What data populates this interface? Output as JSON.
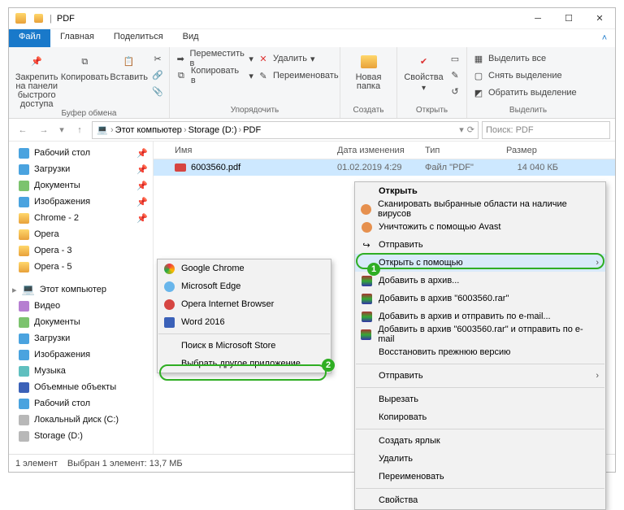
{
  "window": {
    "title": "PDF"
  },
  "tabs": {
    "file": "Файл",
    "home": "Главная",
    "share": "Поделиться",
    "view": "Вид"
  },
  "ribbon": {
    "clipboard": {
      "label": "Буфер обмена",
      "pin": "Закрепить на панели\nбыстрого доступа",
      "copy": "Копировать",
      "paste": "Вставить",
      "cut": "",
      "copypath": "Копировать путь",
      "pastelink": "Вставить ярлык"
    },
    "organize": {
      "label": "Упорядочить",
      "moveto": "Переместить в",
      "copyto": "Копировать в",
      "delete": "Удалить",
      "rename": "Переименовать"
    },
    "new": {
      "label": "Создать",
      "folder": "Новая\nпапка"
    },
    "open": {
      "label": "Открыть",
      "props": "Свойства"
    },
    "select": {
      "label": "Выделить",
      "all": "Выделить все",
      "none": "Снять выделение",
      "invert": "Обратить выделение"
    }
  },
  "breadcrumb": [
    "Этот компьютер",
    "Storage (D:)",
    "PDF"
  ],
  "search": {
    "placeholder": "Поиск: PDF"
  },
  "columns": {
    "name": "Имя",
    "date": "Дата изменения",
    "type": "Тип",
    "size": "Размер"
  },
  "file": {
    "name": "6003560.pdf",
    "date": "01.02.2019 4:29",
    "type": "Файл \"PDF\"",
    "size": "14 040 КБ"
  },
  "sidebar": {
    "desktop": "Рабочий стол",
    "downloads": "Загрузки",
    "documents": "Документы",
    "pictures": "Изображения",
    "chrome2": "Chrome - 2",
    "opera": "Opera",
    "opera3": "Opera - 3",
    "opera5": "Opera - 5",
    "thispc": "Этот компьютер",
    "videos": "Видео",
    "documents2": "Документы",
    "downloads2": "Загрузки",
    "pictures2": "Изображения",
    "music": "Музыка",
    "objects3d": "Объемные объекты",
    "desktop2": "Рабочий стол",
    "diskc": "Локальный диск (C:)",
    "diskd": "Storage (D:)"
  },
  "status": {
    "count": "1 элемент",
    "sel": "Выбран 1 элемент: 13,7 МБ"
  },
  "ctx": {
    "open": "Открыть",
    "scan": "Сканировать выбранные области на наличие вирусов",
    "avast": "Уничтожить с помощью Avast",
    "share": "Отправить",
    "openwith": "Открыть с помощью",
    "addarchive": "Добавить в архив...",
    "addrar": "Добавить в архив \"6003560.rar\"",
    "addemail": "Добавить в архив и отправить по e-mail...",
    "addraremail": "Добавить в архив \"6003560.rar\" и отправить по e-mail",
    "restore": "Восстановить прежнюю версию",
    "send": "Отправить",
    "cut": "Вырезать",
    "copy": "Копировать",
    "shortcut": "Создать ярлык",
    "delete": "Удалить",
    "rename": "Переименовать",
    "props": "Свойства"
  },
  "sub": {
    "chrome": "Google Chrome",
    "edge": "Microsoft Edge",
    "opera": "Opera Internet Browser",
    "word": "Word 2016",
    "store": "Поиск в Microsoft Store",
    "other": "Выбрать другое приложение"
  }
}
